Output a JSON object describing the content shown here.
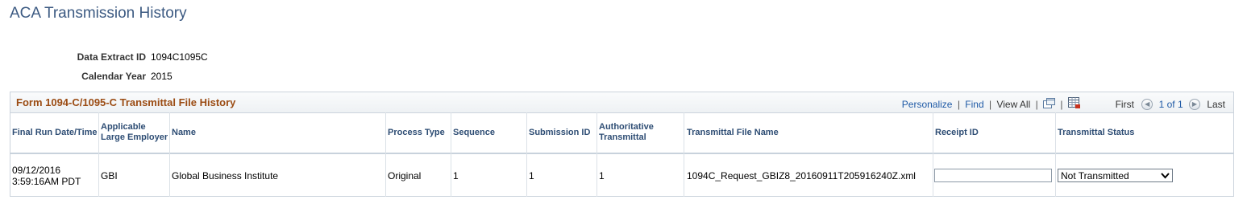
{
  "page": {
    "title": "ACA Transmission History"
  },
  "fields": {
    "data_extract_id_label": "Data Extract ID",
    "data_extract_id_value": "1094C1095C",
    "calendar_year_label": "Calendar Year",
    "calendar_year_value": "2015"
  },
  "grid": {
    "title": "Form 1094-C/1095-C Transmittal File History",
    "nav": {
      "personalize": "Personalize",
      "find": "Find",
      "view_all": "View All",
      "separator": "|",
      "first": "First",
      "pagination": "1 of 1",
      "last": "Last"
    },
    "columns": {
      "final_run": "Final Run Date/Time",
      "employer": "Applicable Large Employer",
      "name": "Name",
      "process_type": "Process Type",
      "sequence": "Sequence",
      "submission_id": "Submission ID",
      "authoritative": "Authoritative Transmittal",
      "file_name": "Transmittal File Name",
      "receipt_id": "Receipt ID",
      "status": "Transmittal Status"
    },
    "rows": [
      {
        "final_run_date": "09/12/2016",
        "final_run_time": "3:59:16AM PDT",
        "employer": "GBI",
        "name": "Global Business Institute",
        "process_type": "Original",
        "sequence": "1",
        "submission_id": "1",
        "authoritative": "1",
        "file_name": "1094C_Request_GBIZ8_20160911T205916240Z.xml",
        "receipt_id": "",
        "status": "Not Transmitted"
      }
    ]
  },
  "colors": {
    "title": "#3c5a82",
    "grid_title": "#9b4c14",
    "link": "#1f5aa6"
  },
  "icons": [
    "new-window-icon",
    "download-grid-icon",
    "previous-icon",
    "next-icon",
    "chevron-down-icon"
  ]
}
